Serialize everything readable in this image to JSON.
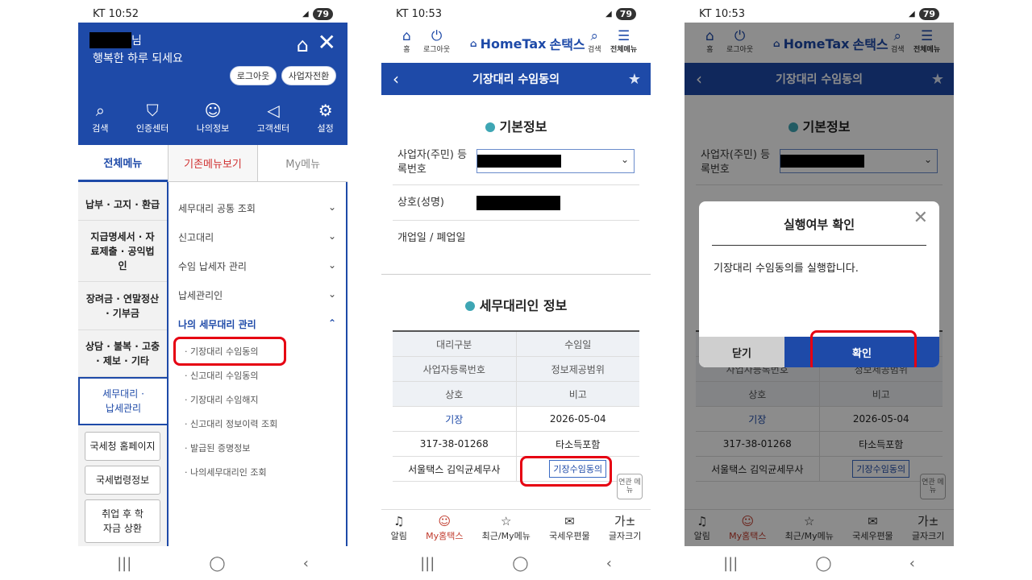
{
  "status": [
    {
      "carrier": "KT",
      "time": "10:52",
      "battery": "79"
    },
    {
      "carrier": "KT",
      "time": "10:53",
      "battery": "79"
    },
    {
      "carrier": "KT",
      "time": "10:53",
      "battery": "79"
    }
  ],
  "menu_screen": {
    "name_suffix": "님",
    "greeting": "행복한 하루 되세요",
    "logout": "로그아웃",
    "switch_business": "사업자전환",
    "icons": [
      "검색",
      "인증센터",
      "나의정보",
      "고객센터",
      "설정"
    ],
    "tabs": [
      "전체메뉴",
      "기존메뉴보기",
      "My메뉴"
    ],
    "left_categories": [
      "납부 · 고지 · 환급",
      "지급명세서 · 자료제출 · 공익법인",
      "장려금 · 연말정산 · 기부금",
      "상담 · 불복 · 고충 · 제보 · 기타",
      "세무대리 · 납세관리"
    ],
    "left_buttons": [
      "국세청 홈페이지",
      "국세법령정보",
      "취업 후 학자금 상환"
    ],
    "right_menus": [
      "세무대리 공통 조회",
      "신고대리",
      "수임 납세자 관리",
      "납세관리인",
      "나의 세무대리 관리"
    ],
    "sub_items": [
      "기장대리 수임동의",
      "신고대리 수임동의",
      "기장대리 수임해지",
      "신고대리 정보이력 조회",
      "발급된 증명정보",
      "나의세무대리인 조회"
    ]
  },
  "detail_screen": {
    "header_icons": [
      "홈",
      "로그아웃",
      "검색",
      "전체메뉴"
    ],
    "logo_en": "HomeTax",
    "logo_ko": "손택스",
    "title": "기장대리 수임동의",
    "basic_info": "기본정보",
    "field_business_no": "사업자(주민) 등록번호",
    "field_company": "상호(성명)",
    "field_open_close": "개업일 / 폐업일",
    "agent_info": "세무대리인 정보",
    "table_head": [
      [
        "대리구분",
        "수임일"
      ],
      [
        "사업자등록번호",
        "정보제공범위"
      ],
      [
        "상호",
        "비고"
      ]
    ],
    "table_rows": [
      [
        "기장",
        "2026-05-04"
      ],
      [
        "317-38-01268",
        "타소득포함"
      ],
      [
        "서울택스 김익균세무사",
        "기장수임동의"
      ]
    ],
    "related_menu": "연관 메뉴",
    "bottom_nav": [
      "알림",
      "My홈택스",
      "최근/My메뉴",
      "국세우편물",
      "글자크기"
    ]
  },
  "dialog": {
    "title": "실행여부 확인",
    "message": "기장대리 수임동의를 실행합니다.",
    "cancel": "닫기",
    "confirm": "확인"
  }
}
